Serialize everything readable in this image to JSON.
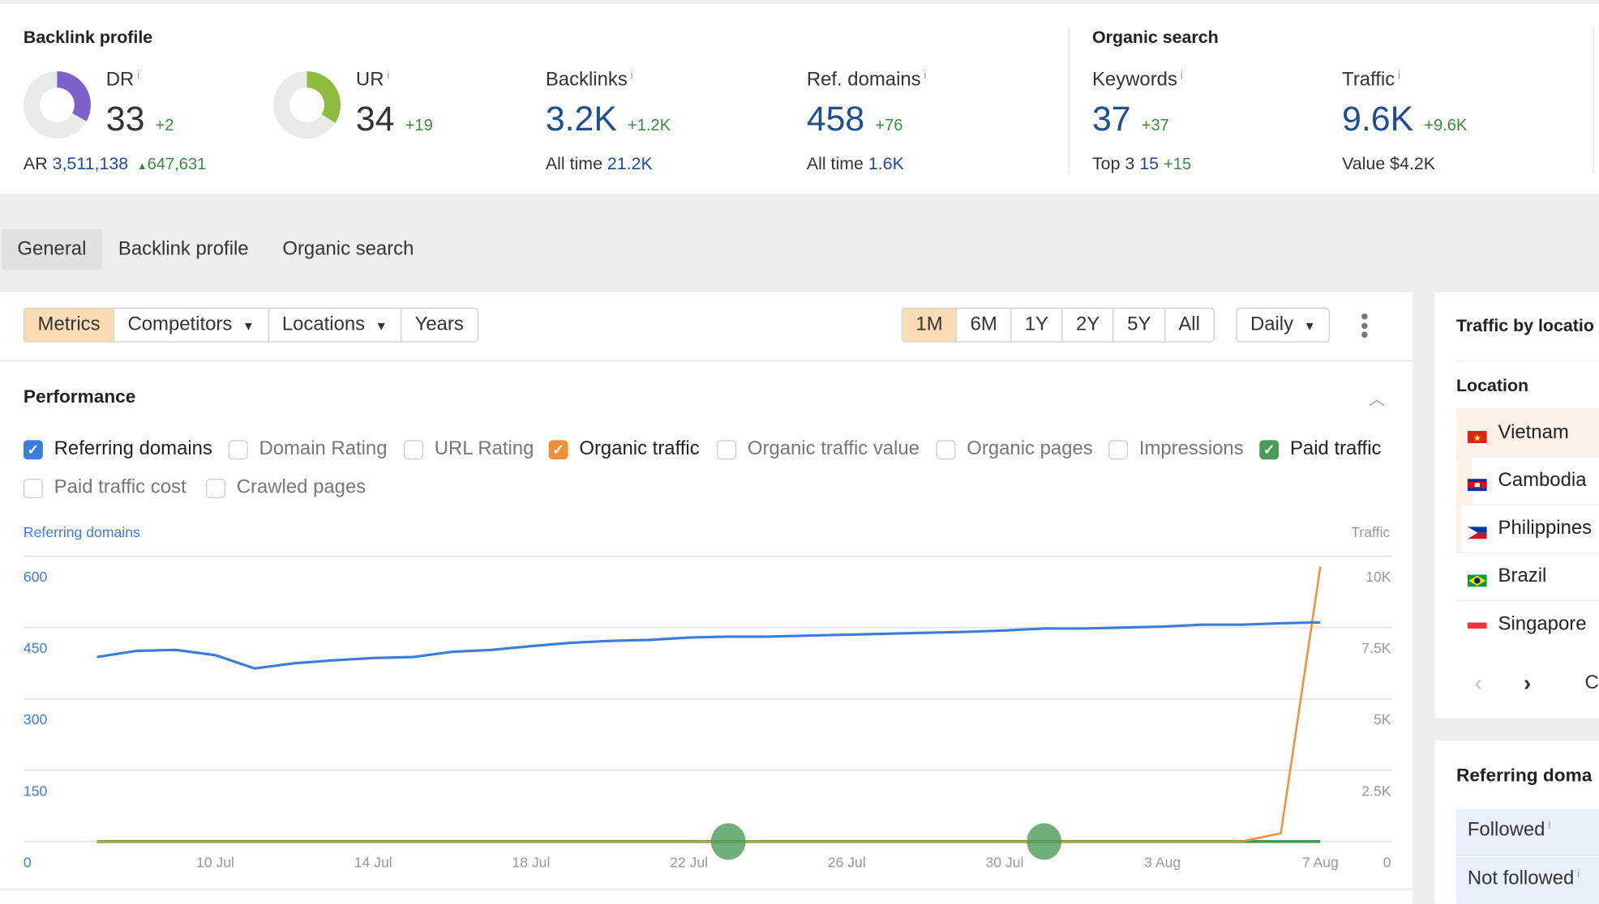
{
  "backlink_profile": {
    "title": "Backlink profile",
    "dr": {
      "label": "DR",
      "value": "33",
      "delta": "+2",
      "fraction": 0.33,
      "color": "#7b61c9"
    },
    "ar": {
      "label": "AR",
      "value": "3,511,138",
      "delta": "647,631"
    },
    "ur": {
      "label": "UR",
      "value": "34",
      "delta": "+19",
      "fraction": 0.34,
      "color": "#8fbb3e"
    },
    "backlinks": {
      "label": "Backlinks",
      "value": "3.2K",
      "delta": "+1.2K",
      "sub_label": "All time",
      "sub_value": "21.2K"
    },
    "ref_domains": {
      "label": "Ref. domains",
      "value": "458",
      "delta": "+76",
      "sub_label": "All time",
      "sub_value": "1.6K"
    }
  },
  "organic_search": {
    "title": "Organic search",
    "keywords": {
      "label": "Keywords",
      "value": "37",
      "delta": "+37",
      "sub_label": "Top 3",
      "sub_value": "15",
      "sub_delta": "+15"
    },
    "traffic": {
      "label": "Traffic",
      "value": "9.6K",
      "delta": "+9.6K",
      "sub_label": "Value",
      "sub_value": "$4.2K"
    }
  },
  "info_glyph": "i",
  "tabs": [
    "General",
    "Backlink profile",
    "Organic search"
  ],
  "toolbar": {
    "left": [
      "Metrics",
      "Competitors",
      "Locations",
      "Years"
    ],
    "ranges": [
      "1M",
      "6M",
      "1Y",
      "2Y",
      "5Y",
      "All"
    ],
    "interval": "Daily"
  },
  "performance": {
    "title": "Performance",
    "checkboxes": [
      {
        "label": "Referring domains",
        "checked": true,
        "color": "#3b7dd8"
      },
      {
        "label": "Domain Rating",
        "checked": false
      },
      {
        "label": "URL Rating",
        "checked": false
      },
      {
        "label": "Organic traffic",
        "checked": true,
        "color": "#f0913a"
      },
      {
        "label": "Organic traffic value",
        "checked": false
      },
      {
        "label": "Organic pages",
        "checked": false
      },
      {
        "label": "Impressions",
        "checked": false
      },
      {
        "label": "Paid traffic",
        "checked": true,
        "color": "#4c9a5a"
      },
      {
        "label": "Paid traffic cost",
        "checked": false
      },
      {
        "label": "Crawled pages",
        "checked": false
      }
    ]
  },
  "chart_data": {
    "type": "line",
    "left_axis_label": "Referring domains",
    "right_axis_label": "Traffic",
    "left_ticks": [
      "0",
      "150",
      "300",
      "450",
      "600"
    ],
    "right_ticks": [
      "0",
      "2.5K",
      "5K",
      "7.5K",
      "10K"
    ],
    "ylim_left": [
      0,
      600
    ],
    "ylim_right": [
      0,
      10000
    ],
    "x_ticks": [
      "10 Jul",
      "14 Jul",
      "18 Jul",
      "22 Jul",
      "26 Jul",
      "30 Jul",
      "3 Aug",
      "7 Aug"
    ],
    "x": [
      "7 Jul",
      "8 Jul",
      "9 Jul",
      "10 Jul",
      "11 Jul",
      "12 Jul",
      "13 Jul",
      "14 Jul",
      "15 Jul",
      "16 Jul",
      "17 Jul",
      "18 Jul",
      "19 Jul",
      "20 Jul",
      "21 Jul",
      "22 Jul",
      "23 Jul",
      "24 Jul",
      "25 Jul",
      "26 Jul",
      "27 Jul",
      "28 Jul",
      "29 Jul",
      "30 Jul",
      "31 Jul",
      "1 Aug",
      "2 Aug",
      "3 Aug",
      "4 Aug",
      "5 Aug",
      "6 Aug",
      "7 Aug"
    ],
    "grid": true,
    "series": [
      {
        "name": "Referring domains",
        "axis": "left",
        "color": "#3b7dd8",
        "values": [
          388,
          401,
          403,
          392,
          364,
          375,
          381,
          386,
          388,
          399,
          403,
          411,
          418,
          422,
          424,
          429,
          431,
          431,
          433,
          435,
          437,
          439,
          441,
          444,
          448,
          448,
          450,
          452,
          456,
          456,
          459,
          461
        ]
      },
      {
        "name": "Organic traffic",
        "axis": "right",
        "color": "#f0913a",
        "values": [
          0,
          0,
          0,
          0,
          0,
          0,
          0,
          0,
          0,
          0,
          0,
          0,
          0,
          0,
          0,
          0,
          0,
          0,
          0,
          0,
          0,
          0,
          0,
          0,
          0,
          0,
          0,
          0,
          0,
          0,
          290,
          9640
        ]
      },
      {
        "name": "Paid traffic",
        "axis": "right",
        "color": "#4c9a5a",
        "values": [
          0,
          0,
          0,
          0,
          0,
          0,
          0,
          0,
          0,
          0,
          0,
          0,
          0,
          0,
          0,
          0,
          0,
          0,
          0,
          0,
          0,
          0,
          0,
          0,
          0,
          0,
          0,
          0,
          0,
          0,
          0,
          0
        ],
        "markers": [
          "23 Jul",
          "31 Jul"
        ]
      }
    ]
  },
  "traffic_by_location": {
    "title": "Traffic by locatio",
    "column": "Location",
    "rows": [
      {
        "name": "Vietnam",
        "flag": "vietnam-flag"
      },
      {
        "name": "Cambodia",
        "flag": "cambodia-flag"
      },
      {
        "name": "Philippines",
        "flag": "philippines-flag"
      },
      {
        "name": "Brazil",
        "flag": "brazil-flag"
      },
      {
        "name": "Singapore",
        "flag": "singapore-flag"
      }
    ],
    "next_partial": "C"
  },
  "referring_domains_card": {
    "title": "Referring doma",
    "rows": [
      "Followed",
      "Not followed"
    ]
  }
}
